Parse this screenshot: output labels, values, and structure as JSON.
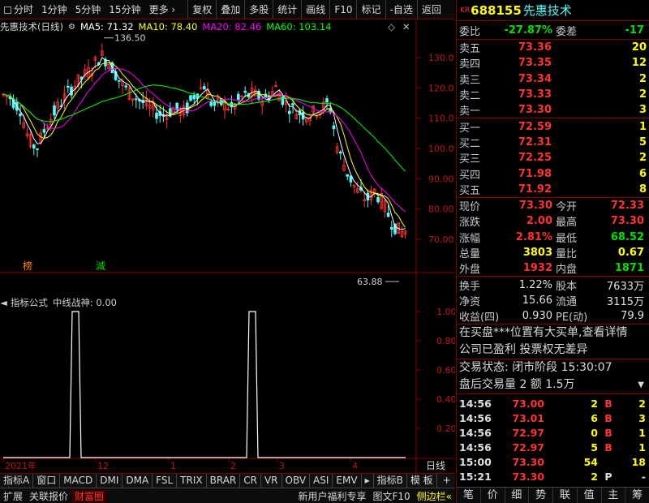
{
  "toolbar": {
    "items": [
      "分时",
      "1分钟",
      "5分钟",
      "15分钟",
      "更多",
      "复权",
      "叠加",
      "多股",
      "统计",
      "画线",
      "F10",
      "标记",
      "-自选",
      "返回"
    ],
    "more_arrow": "›"
  },
  "chart": {
    "stock_label": "先惠技术(日线)",
    "ma5": "MA5: 71.32",
    "ma10": "MA10: 78.40",
    "ma20": "MA20: 82.46",
    "ma60": "MA60: 103.14",
    "high_label": "136.50",
    "low_label": "63.88",
    "y_labels": [
      "130.0",
      "120.0",
      "110.0",
      "100.0",
      "90.00",
      "80.00",
      "70.00"
    ],
    "badge_left": "榜",
    "badge_right": "減",
    "colors": {
      "up": "#ff3232",
      "down": "#54fcfc",
      "ma5": "#ffffff",
      "ma10": "#ffff00",
      "ma20": "#ff00ff",
      "ma60": "#00ff00"
    }
  },
  "indicator": {
    "name": "指标公式",
    "label": "中线战神: 0.00",
    "y_labels": [
      "1.00",
      "0.80",
      "0.60",
      "0.40",
      "0.20"
    ]
  },
  "x_axis": {
    "labels": [
      "2021年",
      "12",
      "1",
      "2",
      "3",
      "4"
    ],
    "scale_label": "日线"
  },
  "bottom_tabs": [
    "指标A",
    "窗口",
    "MACD",
    "DMI",
    "DMA",
    "FSL",
    "TRIX",
    "BRAR",
    "CR",
    "VR",
    "OBV",
    "ASI",
    "EMV",
    "指标B",
    "模 板",
    "+",
    "-"
  ],
  "footer_tabs": [
    "扩展",
    "关联报价",
    "财富圈",
    "新用户福利专享",
    "图文F10",
    "侧边栏"
  ],
  "stock": {
    "prefix": "KR",
    "code": "688155",
    "name": "先惠技术"
  },
  "weibi": {
    "label": "委比",
    "value": "-27.87%",
    "label2": "委差",
    "value2": "-17"
  },
  "sell_orders": [
    {
      "label": "卖五",
      "price": "73.36",
      "volume": "20"
    },
    {
      "label": "卖四",
      "price": "73.35",
      "volume": "12"
    },
    {
      "label": "卖三",
      "price": "73.34",
      "volume": "2"
    },
    {
      "label": "卖二",
      "price": "73.33",
      "volume": "2"
    },
    {
      "label": "卖一",
      "price": "73.30",
      "volume": "3"
    }
  ],
  "buy_orders": [
    {
      "label": "买一",
      "price": "72.59",
      "volume": "1"
    },
    {
      "label": "买二",
      "price": "72.31",
      "volume": "5"
    },
    {
      "label": "买三",
      "price": "72.25",
      "volume": "2"
    },
    {
      "label": "买四",
      "price": "71.98",
      "volume": "6"
    },
    {
      "label": "买五",
      "price": "71.92",
      "volume": "8"
    }
  ],
  "quote": [
    {
      "l1": "现价",
      "v1": "73.30",
      "c1": "#ff3232",
      "l2": "今开",
      "v2": "72.33",
      "c2": "#ff3232"
    },
    {
      "l1": "涨跌",
      "v1": "2.00",
      "c1": "#ff3232",
      "l2": "最高",
      "v2": "73.30",
      "c2": "#ff3232"
    },
    {
      "l1": "涨幅",
      "v1": "2.81%",
      "c1": "#ff3232",
      "l2": "最低",
      "v2": "68.52",
      "c2": "#00e000"
    },
    {
      "l1": "总量",
      "v1": "3803",
      "c1": "#ffff00",
      "l2": "量比",
      "v2": "0.67",
      "c2": "#ffff00"
    },
    {
      "l1": "外盘",
      "v1": "1932",
      "c1": "#ff3232",
      "l2": "内盘",
      "v2": "1871",
      "c2": "#00e000"
    }
  ],
  "stats": [
    {
      "l1": "换手",
      "v1": "1.22%",
      "l2": "股本",
      "v2": "7633万"
    },
    {
      "l1": "净资",
      "v1": "15.66",
      "l2": "流通",
      "v2": "3115万"
    },
    {
      "l1": "收益(四)",
      "v1": "0.930",
      "l2": "PE(动)",
      "v2": "79.9"
    }
  ],
  "messages": [
    "在买盘***位置有大买单,查看详情",
    "公司已盈利 投票权无差异"
  ],
  "trade_status": "交易状态: 闭市阶段 15:30:07",
  "after_hours": "盘后交易量 2 额 1.5万",
  "ticks": [
    {
      "time": "14:56",
      "price": "73.00",
      "vol": "2",
      "dir": "B",
      "n": "2"
    },
    {
      "time": "14:56",
      "price": "73.01",
      "vol": "6",
      "dir": "B",
      "n": "3"
    },
    {
      "time": "14:56",
      "price": "72.97",
      "vol": "0",
      "dir": "B",
      "n": "1"
    },
    {
      "time": "14:56",
      "price": "72.97",
      "vol": "5",
      "dir": "B",
      "n": "1"
    },
    {
      "time": "15:00",
      "price": "73.30",
      "vol": "54",
      "dir": "",
      "n": "18"
    },
    {
      "time": "15:21",
      "price": "73.30",
      "vol": "2",
      "dir": "P",
      "n": "-"
    }
  ],
  "right_tabs": [
    "笔",
    "价",
    "细",
    "势",
    "联",
    "值",
    "主",
    "筹"
  ]
}
